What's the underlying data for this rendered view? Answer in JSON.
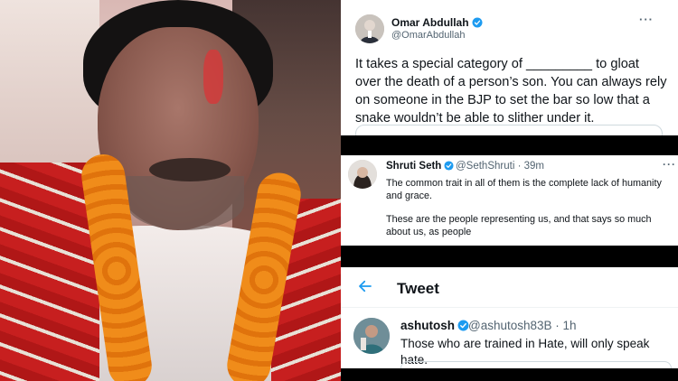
{
  "tweets": [
    {
      "name": "Omar Abdullah",
      "handle": "@OmarAbdullah",
      "verified": true,
      "text": "It takes a special category of _________  to gloat over the death of a person’s son. You can always rely on someone in the BJP to set the bar so low that a snake wouldn’t be able to slither under it."
    },
    {
      "name": "Shruti Seth",
      "handle": "@SethShruti · 39m",
      "verified": true,
      "text": "The common trait in all of them is the complete lack of humanity and grace.",
      "text2": "These are the people representing us, and that says so much about us, as people"
    },
    {
      "header_title": "Tweet",
      "name": "ashutosh",
      "handle": "@ashutosh83B · 1h",
      "verified": true,
      "text": "Those who are trained in Hate, will only speak hate."
    }
  ],
  "icons": {
    "verified": "verified-badge-icon",
    "more": "more-horizontal-icon",
    "back": "back-arrow-icon"
  },
  "colors": {
    "twitter_blue": "#1d9bf0",
    "text": "#0f1419",
    "secondary": "#536471"
  }
}
